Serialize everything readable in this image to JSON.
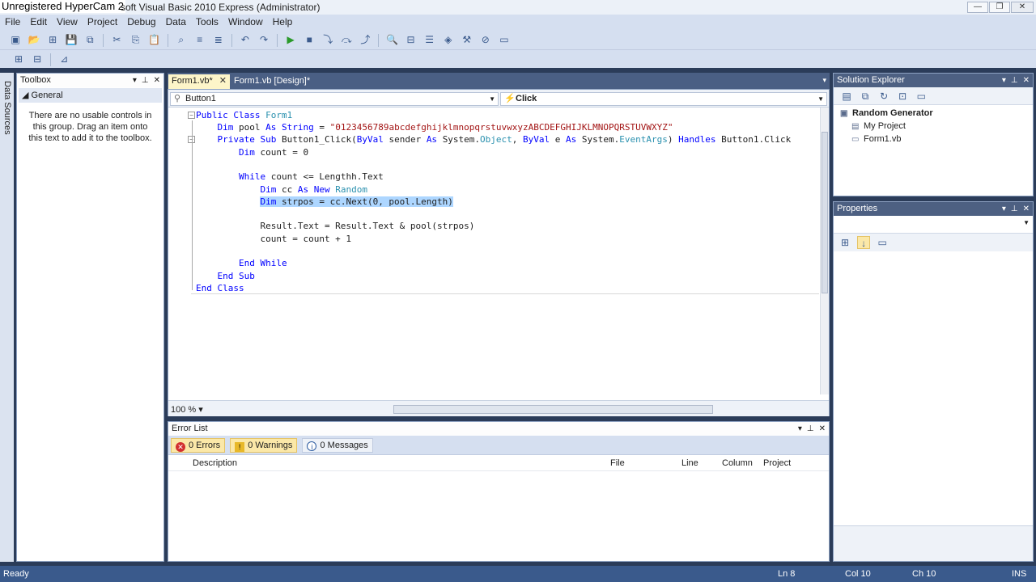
{
  "titlebar": {
    "watermark": "Unregistered HyperCam 2",
    "title": "soft Visual Basic 2010 Express (Administrator)",
    "minimize": "—",
    "maximize": "❐",
    "close": "✕"
  },
  "menu": [
    "File",
    "Edit",
    "View",
    "Project",
    "Debug",
    "Data",
    "Tools",
    "Window",
    "Help"
  ],
  "left_strip": {
    "label": "Data Sources"
  },
  "toolbox": {
    "title": "Toolbox",
    "group": "General",
    "empty_text": "There are no usable controls in this group. Drag an item onto this text to add it to the toolbox."
  },
  "tabs": {
    "code": "Form1.vb*",
    "design": "Form1.vb [Design]*",
    "close": "✕",
    "dropdown": "▾"
  },
  "nav": {
    "object": "Button1",
    "event": "Click"
  },
  "editor": {
    "zoom": "100 %",
    "lines": [
      [
        [
          "kw",
          "Public Class "
        ],
        [
          "ty",
          "Form1"
        ]
      ],
      [
        [
          "",
          "    "
        ],
        [
          "kw",
          "Dim "
        ],
        [
          "",
          "pool "
        ],
        [
          "kw",
          "As String "
        ],
        [
          "",
          "= "
        ],
        [
          "st",
          "\"0123456789abcdefghijklmnopqrstuvwxyzABCDEFGHIJKLMNOPQRSTUVWXYZ\""
        ]
      ],
      [
        [
          "",
          "    "
        ],
        [
          "kw",
          "Private Sub "
        ],
        [
          "",
          "Button1_Click("
        ],
        [
          "kw",
          "ByVal "
        ],
        [
          "",
          "sender "
        ],
        [
          "kw",
          "As "
        ],
        [
          "",
          "System."
        ],
        [
          "ty",
          "Object"
        ],
        [
          "",
          " , "
        ],
        [
          "kw",
          "ByVal "
        ],
        [
          "",
          "e "
        ],
        [
          "kw",
          "As "
        ],
        [
          "",
          "System."
        ],
        [
          "ty",
          "EventArgs"
        ],
        [
          "",
          " ) "
        ],
        [
          "kw",
          "Handles "
        ],
        [
          "",
          "Button1.Click"
        ]
      ],
      [
        [
          "",
          "        "
        ],
        [
          "kw",
          "Dim "
        ],
        [
          "",
          "count = 0"
        ]
      ],
      [
        [
          "",
          ""
        ]
      ],
      [
        [
          "",
          "        "
        ],
        [
          "kw",
          "While "
        ],
        [
          "",
          "count <= Lengthh.Text"
        ]
      ],
      [
        [
          "",
          "            "
        ],
        [
          "kw",
          "Dim "
        ],
        [
          "",
          "cc "
        ],
        [
          "kw",
          "As New "
        ],
        [
          "ty",
          "Random"
        ]
      ],
      [
        [
          "",
          "            "
        ],
        [
          "kw",
          "Dim "
        ],
        [
          "",
          "strpos = cc.Next(0, pool.Length)"
        ]
      ],
      [
        [
          "",
          ""
        ]
      ],
      [
        [
          "",
          "            Result.Text = Result.Text & pool(strpos)"
        ]
      ],
      [
        [
          "",
          "            count = count + 1"
        ]
      ],
      [
        [
          "",
          ""
        ]
      ],
      [
        [
          "",
          "        "
        ],
        [
          "kw",
          "End While"
        ]
      ],
      [
        [
          "",
          "    "
        ],
        [
          "kw",
          "End Sub"
        ]
      ],
      [
        [
          "kw",
          "End Class"
        ]
      ]
    ]
  },
  "error_list": {
    "title": "Error List",
    "errors": "0 Errors",
    "warnings": "0 Warnings",
    "messages": "0 Messages",
    "columns": [
      "Description",
      "File",
      "Line",
      "Column",
      "Project"
    ]
  },
  "solution_explorer": {
    "title": "Solution Explorer",
    "items": [
      "Random Generator",
      "My Project",
      "Form1.vb"
    ]
  },
  "properties": {
    "title": "Properties"
  },
  "status": {
    "ready": "Ready",
    "ln": "Ln 8",
    "col": "Col 10",
    "ch": "Ch 10",
    "ins": "INS"
  }
}
